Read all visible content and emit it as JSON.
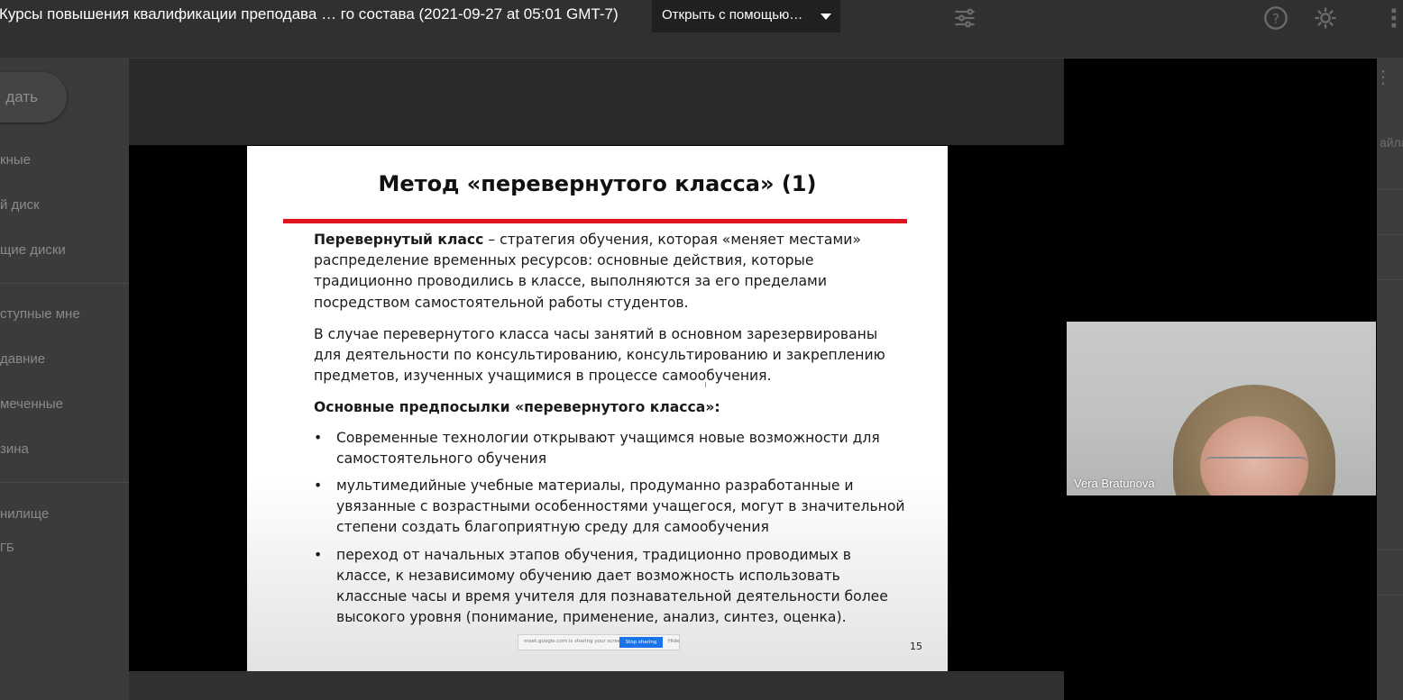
{
  "drive": {
    "create_label": "дать",
    "sidebar_items": [
      "кные",
      "й диск",
      "щие диски",
      "ступные мне",
      "давние",
      "меченные",
      "зина",
      "нилище",
      "ГБ"
    ],
    "right_clip_text": "айла"
  },
  "viewer": {
    "file_title": "Курсы повышения квалификации преподава … го состава (2021-09-27 at 05:01 GMT-7)",
    "open_with_label": "Открыть с помощью…"
  },
  "slide": {
    "title": "Метод «перевернутого класса» (1)",
    "para1_bold": "Перевернутый класс",
    "para1_rest": " – стратегия обучения, которая «меняет местами» распределение временных ресурсов: основные действия, которые традиционно проводились в классе, выполняются за его пределами посредством самостоятельной работы студентов.",
    "para2": "В случае перевернутого класса часы занятий в основном зарезервированы для деятельности по консультированию, консультированию и закреплению предметов, изученных учащимися в процессе самообучения.",
    "subheading": "Основные предпосылки «перевернутого класса»:",
    "bullets": [
      "Современные технологии открывают учащимся новые возможности для самостоятельного обучения",
      "мультимедийные учебные материалы, продуманно разработанные и увязанные с возрастными особенностями учащегося, могут в значительной степени создать благоприятную среду для самообучения",
      "переход от начальных этапов обучения, традиционно проводимых в классе, к независимому обучению дает возможность использовать классные часы и время учителя для познавательной деятельности более высокого уровня (понимание, применение, анализ, синтез, оценка)."
    ],
    "page_number": "15",
    "share_bar": {
      "text": "meet.google.com is sharing your screen.",
      "stop_label": "Stop sharing",
      "hide_label": "Hide"
    }
  },
  "webcam": {
    "participant_name": "Vera Bratunova"
  }
}
